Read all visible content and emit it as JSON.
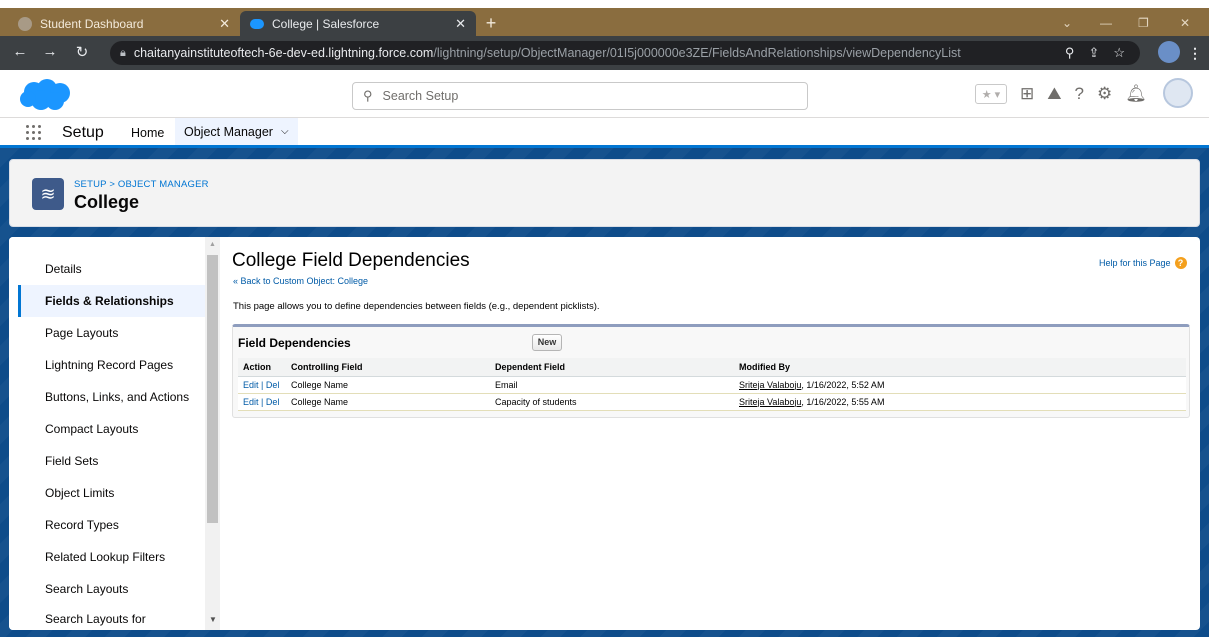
{
  "browser": {
    "tabs": [
      {
        "title": "Student Dashboard",
        "active": false,
        "icon": "globe-icon"
      },
      {
        "title": "College | Salesforce",
        "active": true,
        "icon": "salesforce-cloud-icon"
      }
    ],
    "new_tab": "+",
    "url_host": "chaitanyainstituteoftech-6e-dev-ed.lightning.force.com",
    "url_path": "/lightning/setup/ObjectManager/01I5j000000e3ZE/FieldsAndRelationships/viewDependencyList"
  },
  "header": {
    "search_placeholder": "Search Setup"
  },
  "setup_nav": {
    "title": "Setup",
    "home": "Home",
    "object_manager": "Object Manager"
  },
  "object_header": {
    "breadcrumb": "SETUP > OBJECT MANAGER",
    "title": "College"
  },
  "sidebar": {
    "items": [
      {
        "label": "Details",
        "active": false
      },
      {
        "label": "Fields & Relationships",
        "active": true
      },
      {
        "label": "Page Layouts",
        "active": false
      },
      {
        "label": "Lightning Record Pages",
        "active": false
      },
      {
        "label": "Buttons, Links, and Actions",
        "active": false
      },
      {
        "label": "Compact Layouts",
        "active": false
      },
      {
        "label": "Field Sets",
        "active": false
      },
      {
        "label": "Object Limits",
        "active": false
      },
      {
        "label": "Record Types",
        "active": false
      },
      {
        "label": "Related Lookup Filters",
        "active": false
      },
      {
        "label": "Search Layouts",
        "active": false
      },
      {
        "label": "Search Layouts for",
        "active": false
      }
    ]
  },
  "main": {
    "title": "College Field Dependencies",
    "back_link": "« Back to Custom Object: College",
    "help": "Help for this Page",
    "description": "This page allows you to define dependencies between fields (e.g., dependent picklists).",
    "panel_title": "Field Dependencies",
    "new_button": "New",
    "columns": [
      "Action",
      "Controlling Field",
      "Dependent Field",
      "Modified By"
    ],
    "rows": [
      {
        "edit": "Edit",
        "sep": " | ",
        "del": "Del",
        "controlling": "College Name",
        "dependent": "Email",
        "modified_user": "Sriteja Valaboju",
        "modified_date": ", 1/16/2022, 5:52 AM"
      },
      {
        "edit": "Edit",
        "sep": " | ",
        "del": "Del",
        "controlling": "College Name",
        "dependent": "Capacity of students",
        "modified_user": "Sriteja Valaboju",
        "modified_date": ", 1/16/2022, 5:55 AM"
      }
    ]
  },
  "colors": {
    "brand_blue": "#0176d3",
    "band_blue": "#0e4c8a",
    "chrome_tabbar": "#8a6d3f",
    "chrome_toolbar": "#3c4043",
    "link": "#015ba7"
  }
}
